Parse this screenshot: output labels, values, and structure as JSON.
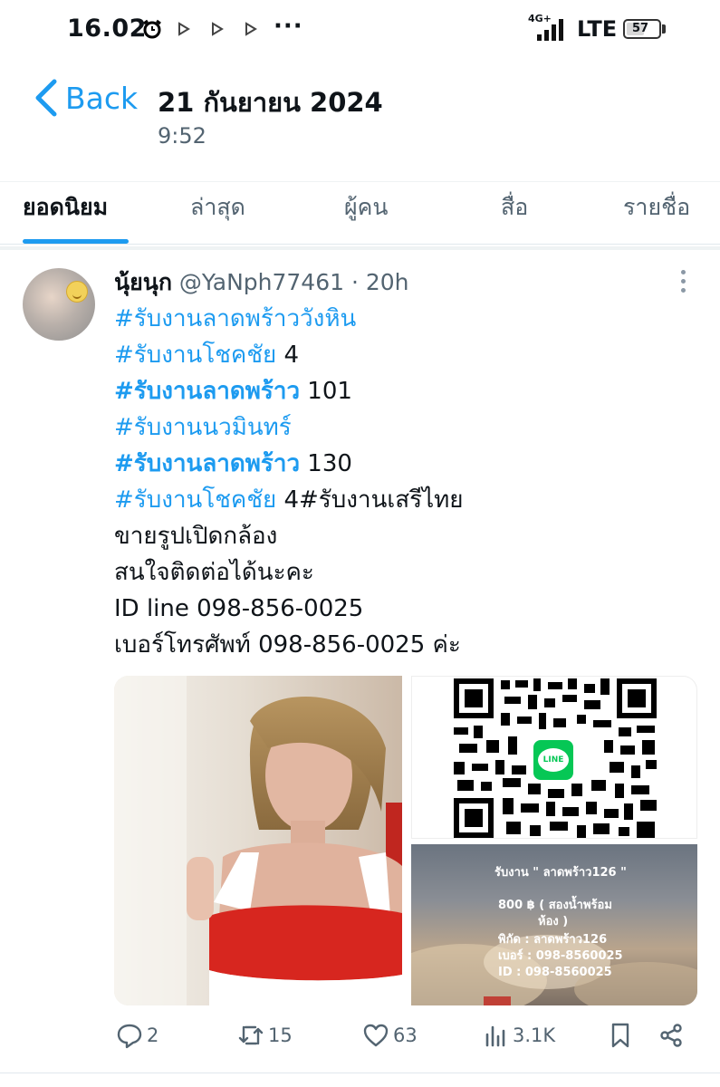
{
  "status_bar": {
    "time": "16.02",
    "dots": "···",
    "network_label": "4G+",
    "network_type": "LTE",
    "battery": "57",
    "battery_level": 0.57
  },
  "header": {
    "back_label": "Back",
    "date": "21 กันยายน 2024",
    "time": "9:52"
  },
  "tabs": [
    {
      "label": "ยอดนิยม",
      "active": true
    },
    {
      "label": "ล่าสุด",
      "active": false
    },
    {
      "label": "ผู้คน",
      "active": false
    },
    {
      "label": "สื่อ",
      "active": false
    },
    {
      "label": "รายชื่อ",
      "active": false
    }
  ],
  "post": {
    "display_name": "นุ้ยนุก",
    "handle": "@YaNph77461",
    "time_ago": "· 20h",
    "lines": [
      {
        "tag": "#รับงานลาดพร้าววังหิน",
        "bold": false,
        "rest": ""
      },
      {
        "tag": "#รับงานโชคชัย",
        "bold": false,
        "rest": " 4"
      },
      {
        "tag": "#รับงานลาดพร้าว",
        "bold": true,
        "rest": " 101"
      },
      {
        "tag": "#รับงานนวมินทร์",
        "bold": false,
        "rest": ""
      },
      {
        "tag": "#รับงานลาดพร้าว",
        "bold": true,
        "rest": " 130"
      },
      {
        "tag": "#รับงานโชคชัย",
        "bold": false,
        "rest": " 4#รับงานเสรีไทย"
      }
    ],
    "text_lines": [
      "ขายรูปเปิดกล้อง",
      "สนใจติดต่อได้นะคะ",
      "ID line 098-856-0025",
      "เบอร์โทรศัพท์ 098-856-0025 ค่ะ"
    ],
    "media": {
      "qr_badge": "LINE",
      "ad_title": "รับงาน \" ลาดพร้าว126 \"",
      "ad_price_1": "800 ฿ ( สองน้ำพร้อม",
      "ad_price_2": "ห้อง )",
      "ad_location": "พิกัด : ลาดพร้าว126",
      "ad_phone": "เบอร์ : 098-8560025",
      "ad_id": "ID    : 098-8560025"
    },
    "actions": {
      "replies": "2",
      "reposts": "15",
      "likes": "63",
      "views": "3.1K"
    }
  },
  "colors": {
    "accent": "#1d9bf0",
    "text": "#0f1419",
    "muted": "#536471",
    "line_green": "#06c755"
  }
}
